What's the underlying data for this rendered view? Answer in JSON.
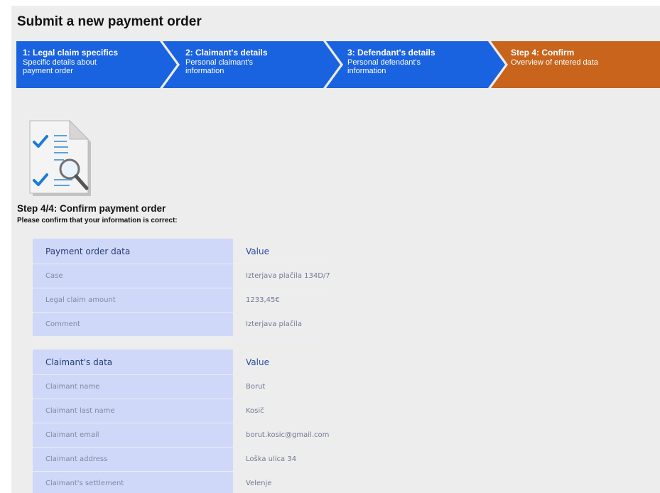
{
  "header": {
    "title": "Submit a new payment order"
  },
  "wizard": {
    "steps": [
      {
        "title": "1: Legal claim specifics",
        "desc": "Specific details about payment order"
      },
      {
        "title": "2: Claimant's details",
        "desc": "Personal claimant's information"
      },
      {
        "title": "3: Defendant's details",
        "desc": "Personal defendant's information"
      },
      {
        "title": "Step 4: Confirm",
        "desc": "Overview of entered data"
      }
    ],
    "colors": {
      "inactive": "#1a63e0",
      "active": "#c8641c"
    }
  },
  "icons": {
    "document": "document-check-magnifier-icon"
  },
  "confirm": {
    "title": "Step 4/4: Confirm payment order",
    "subtitle": "Please confirm that your information is correct:"
  },
  "tables": {
    "payment": {
      "header": [
        "Payment order data",
        "Value"
      ],
      "rows": [
        [
          "Case",
          "Izterjava plačila 134D/7"
        ],
        [
          "Legal claim amount",
          "1233,45€"
        ],
        [
          "Comment",
          "Izterjava plačila"
        ]
      ]
    },
    "claimant": {
      "header": [
        "Claimant's data",
        "Value"
      ],
      "rows": [
        [
          "Claimant name",
          "Borut"
        ],
        [
          "Claimant last name",
          "Kosič"
        ],
        [
          "Claimant email",
          "borut.kosic@gmail.com"
        ],
        [
          "Claimant address",
          "Loška ulica 34"
        ],
        [
          "Claimant's settlement",
          "Velenje"
        ]
      ]
    }
  }
}
